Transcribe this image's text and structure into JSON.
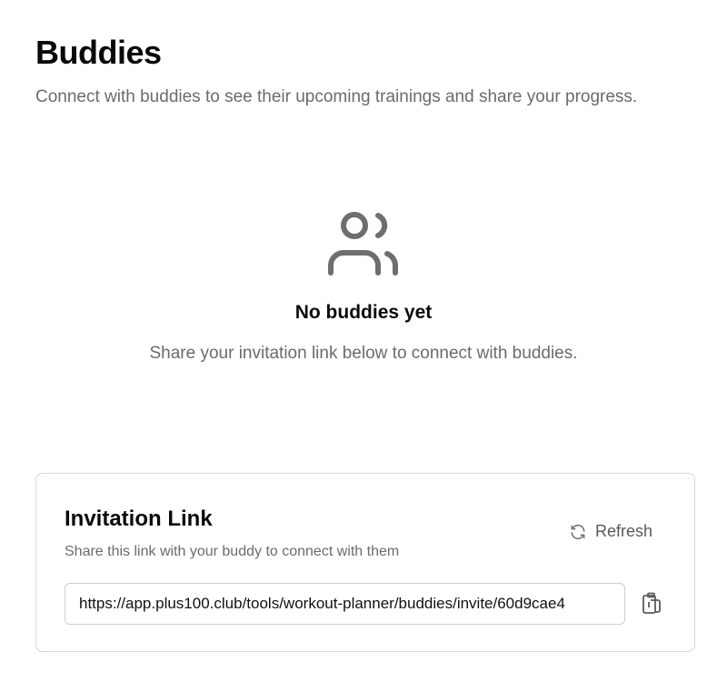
{
  "header": {
    "title": "Buddies",
    "subtitle": "Connect with buddies to see their upcoming trainings and share your progress."
  },
  "empty_state": {
    "icon": "users-icon",
    "title": "No buddies yet",
    "text": "Share your invitation link below to connect with buddies."
  },
  "invitation": {
    "title": "Invitation Link",
    "subtitle": "Share this link with your buddy to connect with them",
    "refresh_label": "Refresh",
    "refresh_icon": "refresh-icon",
    "link_value": "https://app.plus100.club/tools/workout-planner/buddies/invite/60d9cae4",
    "copy_icon": "clipboard-icon"
  },
  "colors": {
    "text_primary": "#0a0a0a",
    "text_muted": "#6b6b6b",
    "icon_gray": "#6e6e6e",
    "border": "#d9d9d9"
  }
}
